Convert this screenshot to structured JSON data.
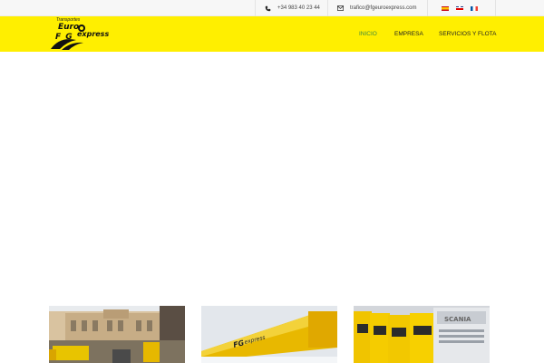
{
  "topbar": {
    "phone": "+34 983 40 23 44",
    "email": "trafico@fgeuroexpress.com",
    "icons": {
      "phone": "phone-icon",
      "email": "envelope-icon"
    },
    "languages": [
      {
        "code": "es",
        "icon": "flag-spain-icon"
      },
      {
        "code": "en",
        "icon": "flag-uk-icon"
      },
      {
        "code": "fr",
        "icon": "flag-france-icon"
      }
    ]
  },
  "logo": {
    "small_text": "Transportes",
    "euro": "Euro",
    "fg": "F G",
    "express": "express"
  },
  "nav": {
    "items": [
      {
        "label": "INICIO",
        "active": true
      },
      {
        "label": "EMPRESA",
        "active": false
      },
      {
        "label": "SERVICIOS Y FLOTA",
        "active": false
      }
    ]
  },
  "colors": {
    "header_bg": "#ffef00",
    "active_nav": "#3d8b3d",
    "topbar_bg": "#f7f7f7"
  },
  "thumbnails": [
    {
      "subject": "historic-building-with-trucks"
    },
    {
      "subject": "yellow-trailer-in-snow"
    },
    {
      "subject": "yellow-truck-fleet"
    }
  ]
}
